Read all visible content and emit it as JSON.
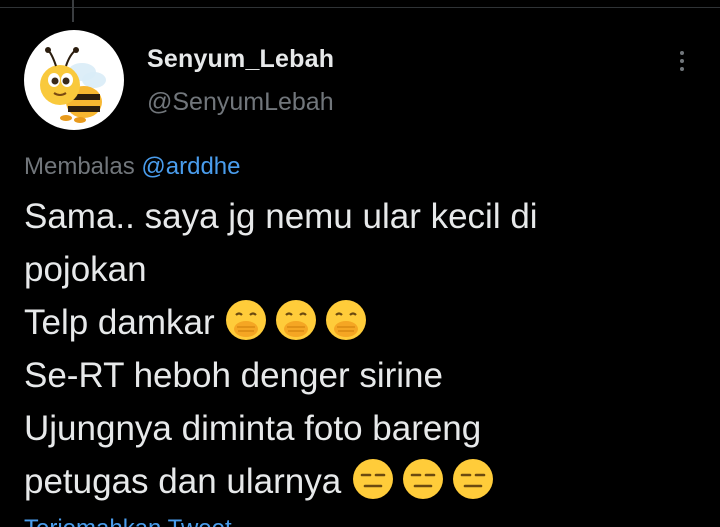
{
  "tweet": {
    "author": {
      "display_name": "Senyum_Lebah",
      "handle": "@SenyumLebah",
      "avatar_icon": "bee-mascot-icon"
    },
    "reply": {
      "prefix": "Membalas",
      "mention": "@arddhe"
    },
    "body_lines": [
      "Sama.. saya jg nemu ular kecil di",
      "pojokan",
      "Telp damkar",
      "Se-RT heboh denger sirine",
      "Ujungnya diminta foto bareng",
      "petugas dan ularnya"
    ],
    "emojis": {
      "line3": [
        "face-with-hand-over-mouth-icon",
        "face-with-hand-over-mouth-icon",
        "face-with-hand-over-mouth-icon"
      ],
      "line6": [
        "expressionless-face-icon",
        "expressionless-face-icon",
        "expressionless-face-icon"
      ]
    },
    "more_menu_icon": "more-options-icon",
    "translate_link": "Terjemahkan Tweet"
  },
  "colors": {
    "background": "#000000",
    "text_primary": "#e7e9ea",
    "text_secondary": "#71767b",
    "link": "#4a9ded",
    "emoji_yellow": "#ffcc3a"
  }
}
